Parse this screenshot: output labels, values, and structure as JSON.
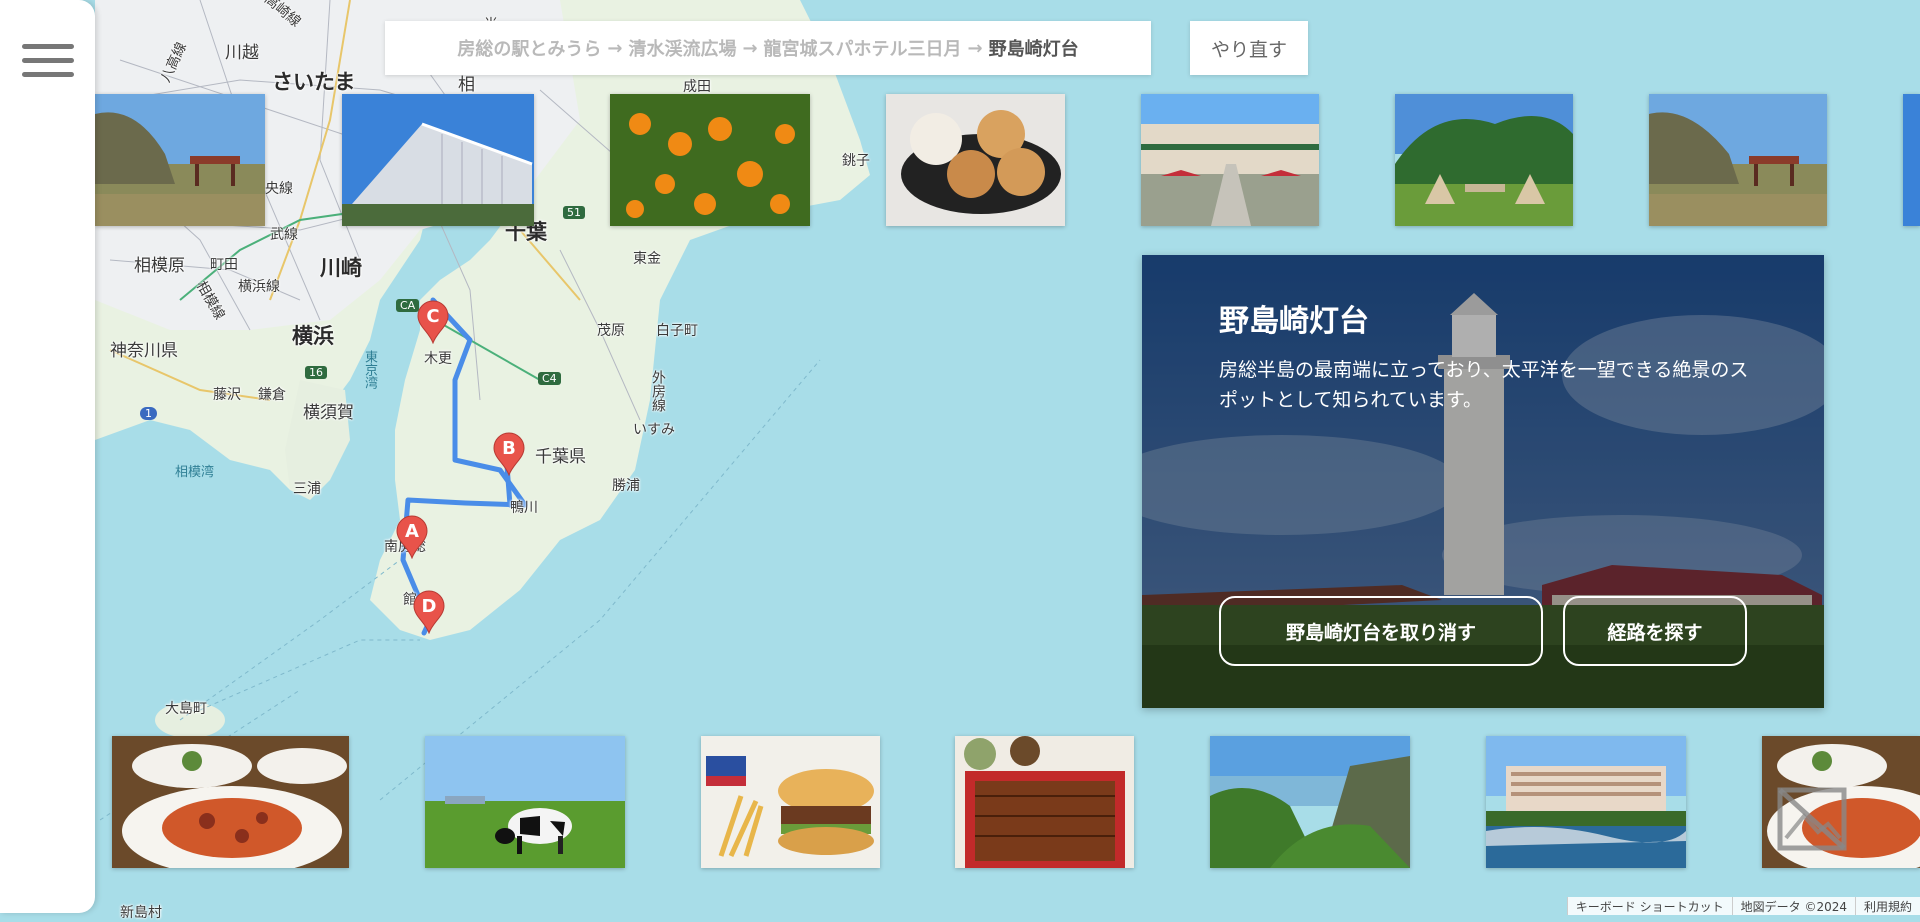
{
  "route": {
    "stops": [
      "房総の駅とみうら",
      "清水渓流広場",
      "龍宮城スパホテル三日月"
    ],
    "destination": "野島崎灯台",
    "arrow": "→"
  },
  "redo_label": "やり直す",
  "detail": {
    "title": "野島崎灯台",
    "description": "房総半島の最南端に立っており、太平洋を一望できる絶景のスポットとして知られています。",
    "cancel_label": "野島崎灯台を取り消す",
    "route_label": "経路を探す"
  },
  "map_labels": [
    {
      "text": "川越"
    },
    {
      "text": "さいたま"
    },
    {
      "text": "相"
    },
    {
      "text": "尚"
    },
    {
      "text": "央線"
    },
    {
      "text": "武線"
    },
    {
      "text": "相模原"
    },
    {
      "text": "町田"
    },
    {
      "text": "川崎"
    },
    {
      "text": "横浜線"
    },
    {
      "text": "横浜"
    },
    {
      "text": "神奈川県"
    },
    {
      "text": "千葉"
    },
    {
      "text": "銚子"
    },
    {
      "text": "東金"
    },
    {
      "text": "茂原"
    },
    {
      "text": "白子町"
    },
    {
      "text": "木更"
    },
    {
      "text": "千葉県"
    },
    {
      "text": "外房線"
    },
    {
      "text": "いすみ"
    },
    {
      "text": "勝浦"
    },
    {
      "text": "鴨川"
    },
    {
      "text": "南房総"
    },
    {
      "text": "館"
    },
    {
      "text": "藤沢"
    },
    {
      "text": "鎌倉"
    },
    {
      "text": "横須賀"
    },
    {
      "text": "三浦"
    },
    {
      "text": "相模湾"
    },
    {
      "text": "大島町"
    },
    {
      "text": "新島村"
    },
    {
      "text": "東京湾"
    },
    {
      "text": "高崎線"
    },
    {
      "text": "八高線"
    },
    {
      "text": "成田"
    },
    {
      "text": "相模線"
    }
  ],
  "road_shields": [
    "51",
    "CA",
    "16",
    "1",
    "C4"
  ],
  "markers": [
    "A",
    "B",
    "C",
    "D"
  ],
  "top_photos": [
    {
      "subject": "coastal-pavilion"
    },
    {
      "subject": "glass-building"
    },
    {
      "subject": "mandarin-oranges"
    },
    {
      "subject": "sweets"
    },
    {
      "subject": "courtyard-hotel"
    },
    {
      "subject": "camping-tents"
    },
    {
      "subject": "coastal-pavilion"
    },
    {
      "subject": "partial"
    }
  ],
  "bottom_photos": [
    {
      "subject": "pasta"
    },
    {
      "subject": "cow-pasture"
    },
    {
      "subject": "hamburger"
    },
    {
      "subject": "unagi"
    },
    {
      "subject": "cliffs"
    },
    {
      "subject": "seaside-hotel"
    },
    {
      "subject": "pasta"
    }
  ],
  "footer": {
    "shortcuts": "キーボード ショートカット",
    "map_data": "地図データ ©2024",
    "terms": "利用規約"
  },
  "colors": {
    "route": "#4a8de8",
    "marker": "#e8534a",
    "sea": "#a8dde8",
    "land": "#e8f2e0"
  }
}
